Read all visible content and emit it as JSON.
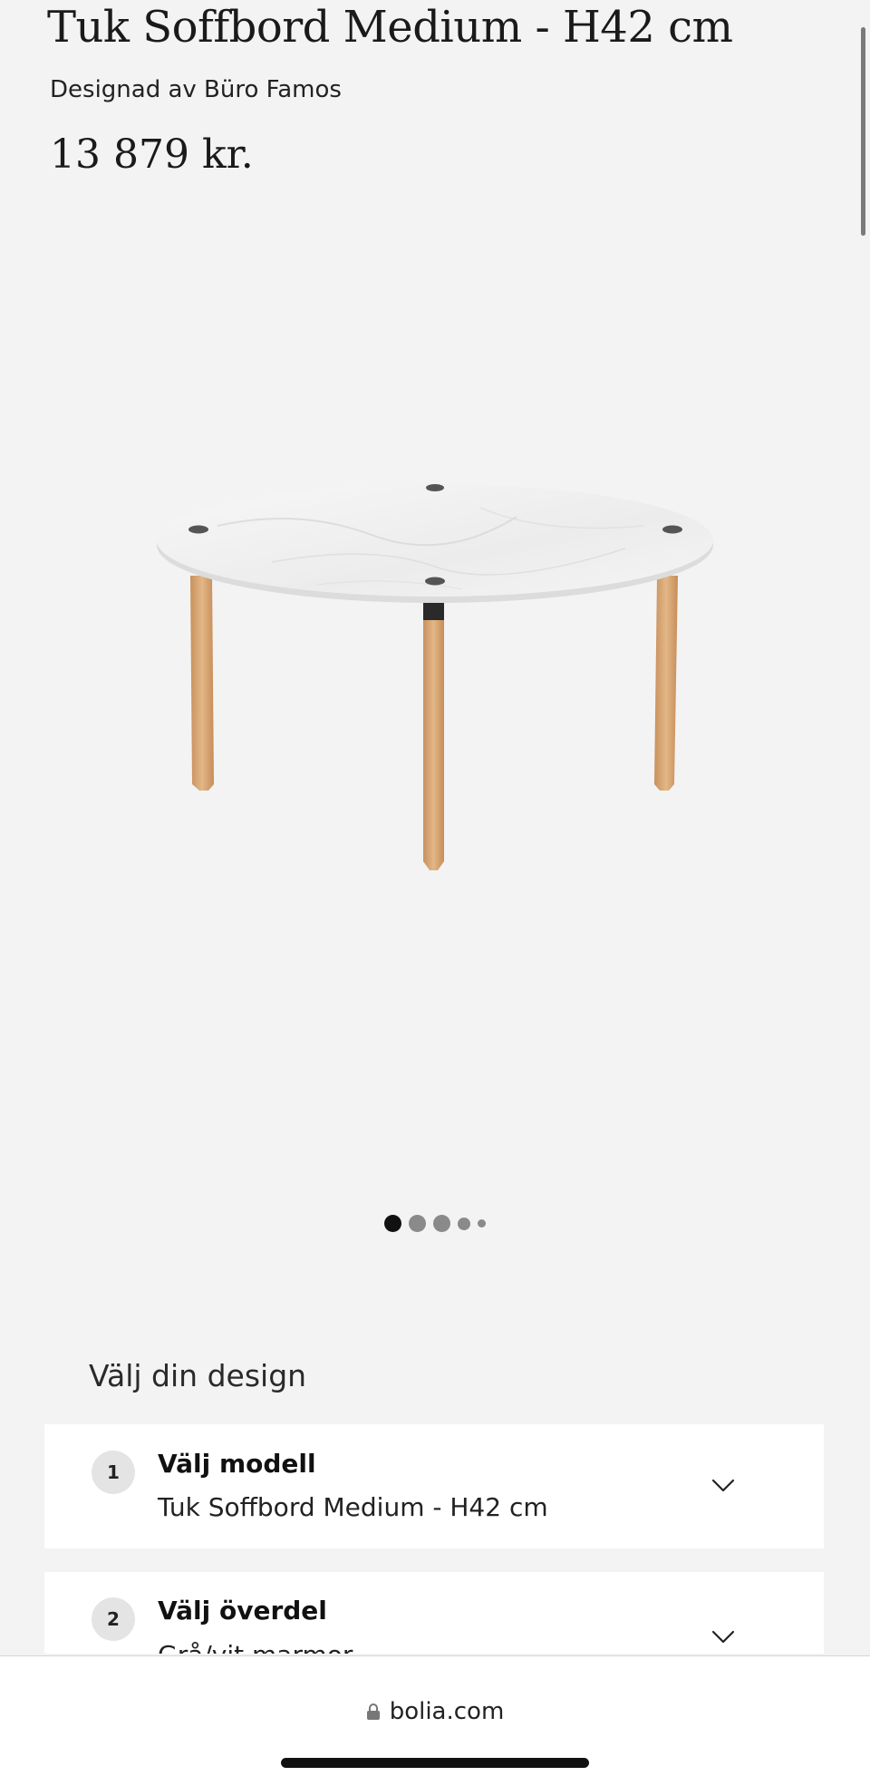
{
  "product": {
    "title": "Tuk Soffbord Medium - H42 cm",
    "designer": "Designad av Büro Famos",
    "price": "13 879 kr."
  },
  "image": {
    "subject": "coffee-table",
    "icon": "product-photo"
  },
  "carousel": {
    "total": 5,
    "active_index": 0
  },
  "configurator": {
    "heading": "Välj din design",
    "steps": [
      {
        "number": "1",
        "title": "Välj modell",
        "value": "Tuk Soffbord Medium - H42 cm"
      },
      {
        "number": "2",
        "title": "Välj överdel",
        "value": "Grå/vit marmor"
      }
    ]
  },
  "browser": {
    "url": "bolia.com",
    "lock_icon": "lock-icon"
  },
  "colors": {
    "background": "#f3f3f3",
    "card": "#ffffff",
    "badge": "#e4e4e4",
    "wood": "#d9a877",
    "marble": "#f1f1f1"
  }
}
